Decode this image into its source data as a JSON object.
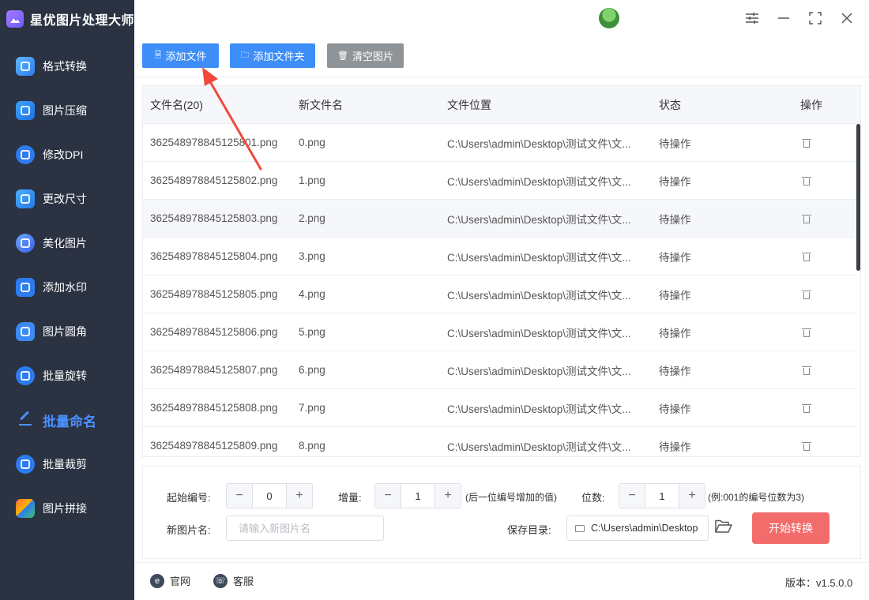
{
  "app": {
    "title": "星优图片处理大师"
  },
  "sidebar": {
    "items": [
      {
        "label": "格式转换",
        "icon": "image-convert-icon"
      },
      {
        "label": "图片压缩",
        "icon": "image-compress-icon"
      },
      {
        "label": "修改DPI",
        "icon": "dpi-icon"
      },
      {
        "label": "更改尺寸",
        "icon": "resize-icon"
      },
      {
        "label": "美化图片",
        "icon": "beautify-icon"
      },
      {
        "label": "添加水印",
        "icon": "watermark-icon"
      },
      {
        "label": "图片圆角",
        "icon": "round-corner-icon"
      },
      {
        "label": "批量旋转",
        "icon": "rotate-icon"
      },
      {
        "label": "批量命名",
        "icon": "rename-icon",
        "active": true
      },
      {
        "label": "批量裁剪",
        "icon": "crop-icon"
      },
      {
        "label": "图片拼接",
        "icon": "stitch-icon"
      }
    ]
  },
  "toolbar": {
    "add_file": "添加文件",
    "add_folder": "添加文件夹",
    "clear": "清空图片"
  },
  "table": {
    "headers": [
      "文件名(20)",
      "新文件名",
      "文件位置",
      "状态",
      "操作"
    ],
    "rows": [
      {
        "name": "362548978845125801.png",
        "new_name": "0.png",
        "location": "C:\\Users\\admin\\Desktop\\测试文件\\文...",
        "status": "待操作"
      },
      {
        "name": "362548978845125802.png",
        "new_name": "1.png",
        "location": "C:\\Users\\admin\\Desktop\\测试文件\\文...",
        "status": "待操作"
      },
      {
        "name": "362548978845125803.png",
        "new_name": "2.png",
        "location": "C:\\Users\\admin\\Desktop\\测试文件\\文...",
        "status": "待操作"
      },
      {
        "name": "362548978845125804.png",
        "new_name": "3.png",
        "location": "C:\\Users\\admin\\Desktop\\测试文件\\文...",
        "status": "待操作"
      },
      {
        "name": "362548978845125805.png",
        "new_name": "4.png",
        "location": "C:\\Users\\admin\\Desktop\\测试文件\\文...",
        "status": "待操作"
      },
      {
        "name": "362548978845125806.png",
        "new_name": "5.png",
        "location": "C:\\Users\\admin\\Desktop\\测试文件\\文...",
        "status": "待操作"
      },
      {
        "name": "362548978845125807.png",
        "new_name": "6.png",
        "location": "C:\\Users\\admin\\Desktop\\测试文件\\文...",
        "status": "待操作"
      },
      {
        "name": "362548978845125808.png",
        "new_name": "7.png",
        "location": "C:\\Users\\admin\\Desktop\\测试文件\\文...",
        "status": "待操作"
      },
      {
        "name": "362548978845125809.png",
        "new_name": "8.png",
        "location": "C:\\Users\\admin\\Desktop\\测试文件\\文...",
        "status": "待操作"
      }
    ]
  },
  "settings": {
    "start_label": "起始编号:",
    "start_value": "0",
    "increment_label": "增量:",
    "increment_value": "1",
    "increment_hint": "(后一位编号增加的值)",
    "digits_label": "位数:",
    "digits_value": "1",
    "digits_hint": "(例:001的编号位数为3)",
    "new_name_label": "新图片名:",
    "new_name_placeholder": "请输入新图片名",
    "save_dir_label": "保存目录:",
    "save_dir_value": "C:\\Users\\admin\\Desktop",
    "start_button": "开始转换"
  },
  "footer": {
    "website": "官网",
    "support": "客服",
    "version": "版本：v1.5.0.0"
  },
  "colors": {
    "sidebar_bg": "#2b3242",
    "primary": "#3d8ef8",
    "clear_btn": "#8f9499",
    "start_btn": "#f26c6c",
    "active_nav": "#4a90ff",
    "arrow": "#f04a3a"
  }
}
